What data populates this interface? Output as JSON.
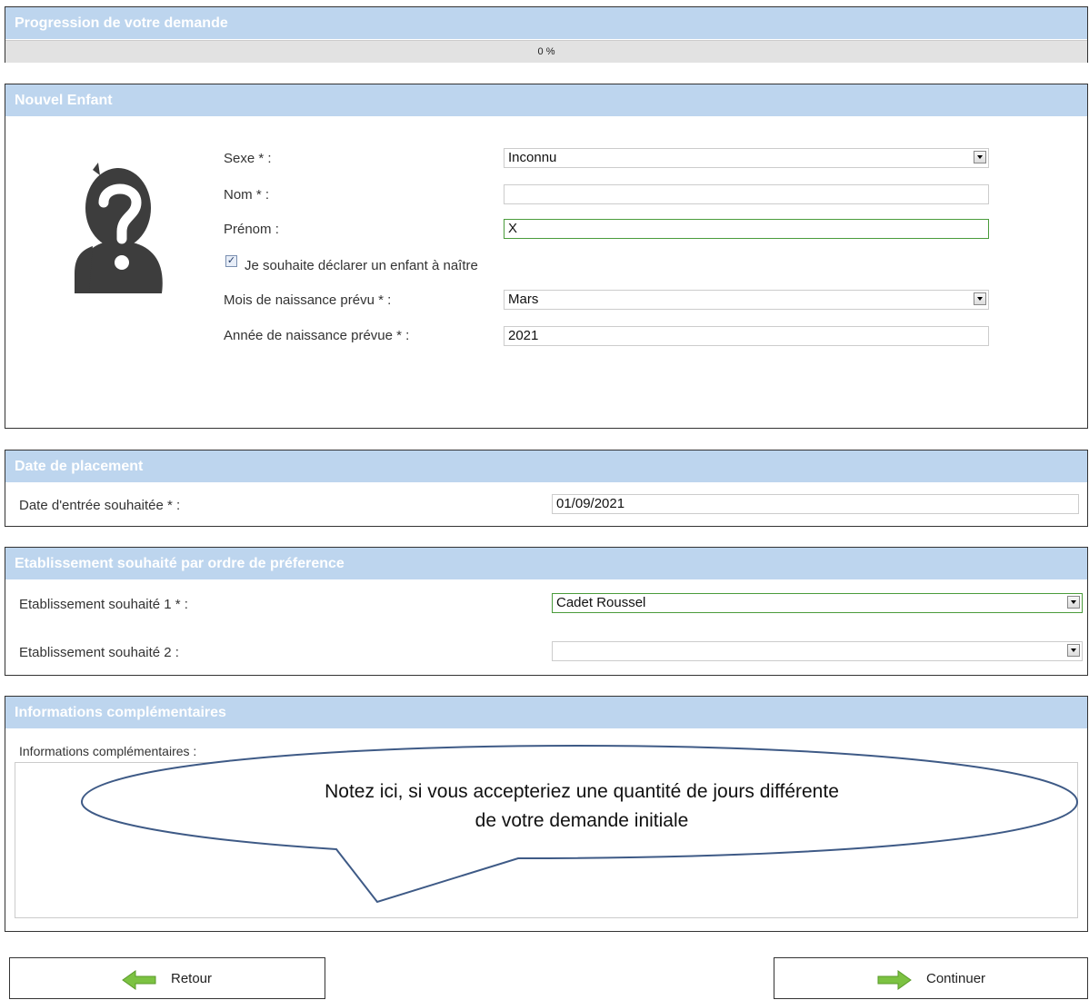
{
  "progress": {
    "title": "Progression de votre demande",
    "value_text": "0 %",
    "fraction": 0
  },
  "child": {
    "title": "Nouvel Enfant",
    "sexe_label": "Sexe * :",
    "sexe_value": "Inconnu",
    "nom_label": "Nom * :",
    "nom_value": "",
    "prenom_label": "Prénom :",
    "prenom_value": "X",
    "unborn_checkbox_label": "Je souhaite déclarer un enfant à naître",
    "unborn_checked": true,
    "mois_label": "Mois de naissance prévu * :",
    "mois_value": "Mars",
    "annee_label": "Année de naissance prévue * :",
    "annee_value": "2021",
    "avatar_icon": "unknown-person-icon"
  },
  "placement": {
    "title": "Date de placement",
    "date_label": "Date d'entrée souhaitée * :",
    "date_value": "01/09/2021"
  },
  "establishment": {
    "title": "Etablissement souhaité par ordre de préference",
    "pref1_label": "Etablissement souhaité 1 * :",
    "pref1_value": "Cadet Roussel",
    "pref2_label": "Etablissement souhaité 2 :",
    "pref2_value": ""
  },
  "info": {
    "title": "Informations complémentaires",
    "field_label": "Informations complémentaires :",
    "callout_line1": "Notez ici, si vous accepteriez une quantité de jours différente",
    "callout_line2": "de votre demande initiale"
  },
  "buttons": {
    "back_label": "Retour",
    "back_icon": "arrow-left-icon",
    "continue_label": "Continuer",
    "continue_icon": "arrow-right-icon"
  },
  "colors": {
    "header_blue": "#bdd5ee",
    "arrow_green": "#7cc242",
    "valid_border": "#4a9c3b"
  }
}
